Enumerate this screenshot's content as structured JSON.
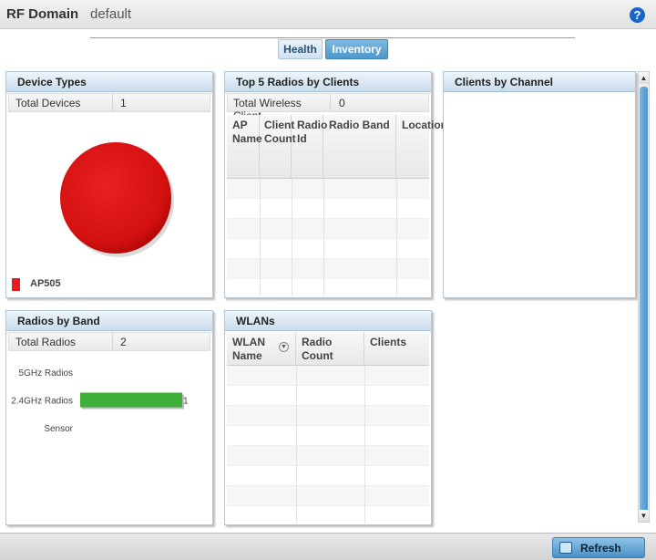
{
  "header": {
    "title": "RF Domain",
    "subtitle": "default",
    "help_icon": "?"
  },
  "tabs": [
    {
      "label": "Health"
    },
    {
      "label": "Inventory"
    }
  ],
  "device_types": {
    "title": "Device Types",
    "total_label": "Total Devices",
    "total_value": "1",
    "legend": [
      {
        "label": "AP505",
        "color": "#e81c1c"
      }
    ],
    "chart_data": {
      "type": "pie",
      "categories": [
        "AP505"
      ],
      "values": [
        1
      ],
      "colors": [
        "#e01010"
      ]
    }
  },
  "top_radios": {
    "title": "Top 5 Radios by Clients",
    "total_label": "Total Wireless Client",
    "total_value": "0",
    "columns": [
      "AP Name",
      "Client Count",
      "Radio Id",
      "Radio Band",
      "Location"
    ]
  },
  "clients_by_channel": {
    "title": "Clients by Channel"
  },
  "radios_by_band": {
    "title": "Radios by Band",
    "total_label": "Total Radios",
    "total_value": "2",
    "chart_data": {
      "type": "bar",
      "orientation": "horizontal",
      "categories": [
        "5GHz Radios",
        "2.4GHz Radios",
        "Sensor"
      ],
      "values": [
        0,
        1,
        0
      ],
      "bar_color": "#3db03a",
      "value_labels": [
        "",
        "1",
        ""
      ]
    }
  },
  "wlans": {
    "title": "WLANs",
    "columns": [
      "WLAN Name",
      "Radio Count",
      "Clients"
    ]
  },
  "footer": {
    "refresh_label": "Refresh"
  }
}
